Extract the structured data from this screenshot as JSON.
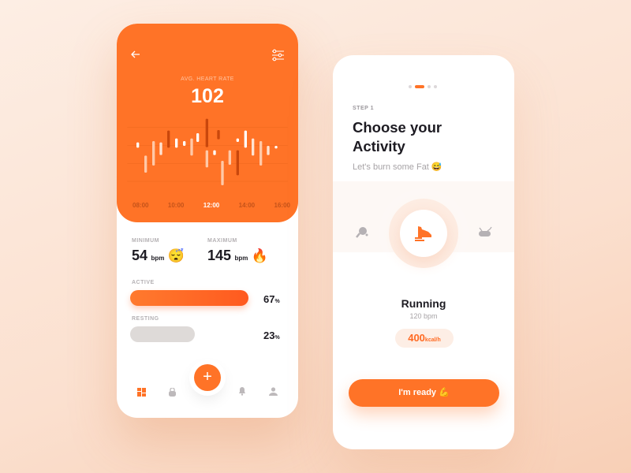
{
  "heart": {
    "back_icon": "arrow-left-icon",
    "filter_icon": "sliders-icon",
    "label": "AVG. HEART RATE",
    "value": "102",
    "times": [
      "08:00",
      "10:00",
      "12:00",
      "14:00",
      "16:00"
    ],
    "selected_time": "12:00",
    "minimum": {
      "label": "MINIMUM",
      "value": "54",
      "unit": "bpm",
      "emoji": "😴"
    },
    "maximum": {
      "label": "MAXIMUM",
      "value": "145",
      "unit": "bpm",
      "emoji": "🔥"
    },
    "active": {
      "label": "ACTIVE",
      "value": "67",
      "unit": "%",
      "percent": 67
    },
    "resting": {
      "label": "RESTING",
      "value": "23",
      "unit": "%",
      "percent": 23
    },
    "nav": [
      "dashboard-icon",
      "kettlebell-icon",
      "plus-icon",
      "bell-icon",
      "user-icon"
    ]
  },
  "activity": {
    "step": "STEP 1",
    "title_line1": "Choose your",
    "title_line2": "Activity",
    "subtitle": "Let's burn some Fat 😅",
    "page_dots": 4,
    "active_dot": 2,
    "options": [
      "tennis-icon",
      "running-shoe-icon",
      "rowing-icon"
    ],
    "name": "Running",
    "bpm": "120 bpm",
    "kcal": "400",
    "kcal_unit": "kcal/h",
    "cta": "I'm ready 💪"
  },
  "colors": {
    "accent": "#ff7327",
    "dark": "#1d1b22"
  }
}
